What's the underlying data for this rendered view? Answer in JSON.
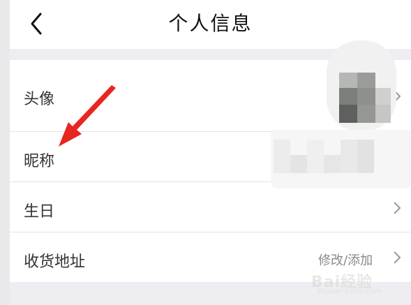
{
  "header": {
    "title": "个人信息"
  },
  "rows": [
    {
      "label": "头像",
      "value": ""
    },
    {
      "label": "昵称",
      "value": ""
    },
    {
      "label": "生日",
      "value": ""
    },
    {
      "label": "收货地址",
      "value": "修改/添加"
    }
  ],
  "watermark": {
    "brand": "Bai经验",
    "url": "jingyan.baidu.com"
  },
  "icons": {
    "back": "back-chevron-icon",
    "chevron": "chevron-right-icon",
    "annotation": "red-arrow"
  },
  "colors": {
    "annotation": "#e8251f",
    "separator": "#eeeef2"
  }
}
